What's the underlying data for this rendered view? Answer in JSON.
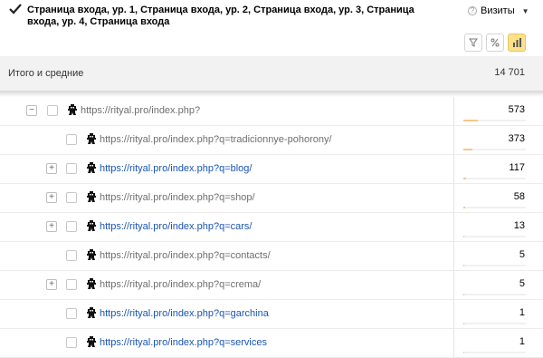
{
  "header": {
    "title": "Страница входа, ур. 1, Страница входа, ур. 2, Страница входа, ур. 3, Страница входа, ур. 4, Страница входа",
    "metric_label": "Визиты",
    "help_icon": "question-icon",
    "caret_icon": "triangle-down-icon",
    "toolbar": [
      "filter-icon",
      "percent-icon",
      "bar-chart-icon"
    ]
  },
  "totals": {
    "label": "Итого и средние",
    "value": "14 701"
  },
  "colors": {
    "link": "#1a55b3",
    "link_muted": "#6f6f6f",
    "bar": "#f5c88a",
    "active_toggle": "#fde08a"
  },
  "rows": [
    {
      "url": "https://rityal.pro/index.php?",
      "value": "573",
      "expander": "−",
      "style": "gray",
      "bar": 0.039
    },
    {
      "url": "https://rityal.pro/index.php?q=tradicionnye-pohorony/",
      "value": "373",
      "expander": "",
      "style": "gray",
      "bar": 0.025
    },
    {
      "url": "https://rityal.pro/index.php?q=blog/",
      "value": "117",
      "expander": "+",
      "style": "blue",
      "bar": 0.008
    },
    {
      "url": "https://rityal.pro/index.php?q=shop/",
      "value": "58",
      "expander": "+",
      "style": "gray",
      "bar": 0.004
    },
    {
      "url": "https://rityal.pro/index.php?q=cars/",
      "value": "13",
      "expander": "+",
      "style": "blue",
      "bar": 0.001
    },
    {
      "url": "https://rityal.pro/index.php?q=contacts/",
      "value": "5",
      "expander": "",
      "style": "gray",
      "bar": 0.0003
    },
    {
      "url": "https://rityal.pro/index.php?q=crema/",
      "value": "5",
      "expander": "+",
      "style": "gray",
      "bar": 0.0003
    },
    {
      "url": "https://rityal.pro/index.php?q=garchina",
      "value": "1",
      "expander": "",
      "style": "blue",
      "bar": 0.0001
    },
    {
      "url": "https://rityal.pro/index.php?q=services",
      "value": "1",
      "expander": "",
      "style": "blue",
      "bar": 0.0001
    }
  ]
}
